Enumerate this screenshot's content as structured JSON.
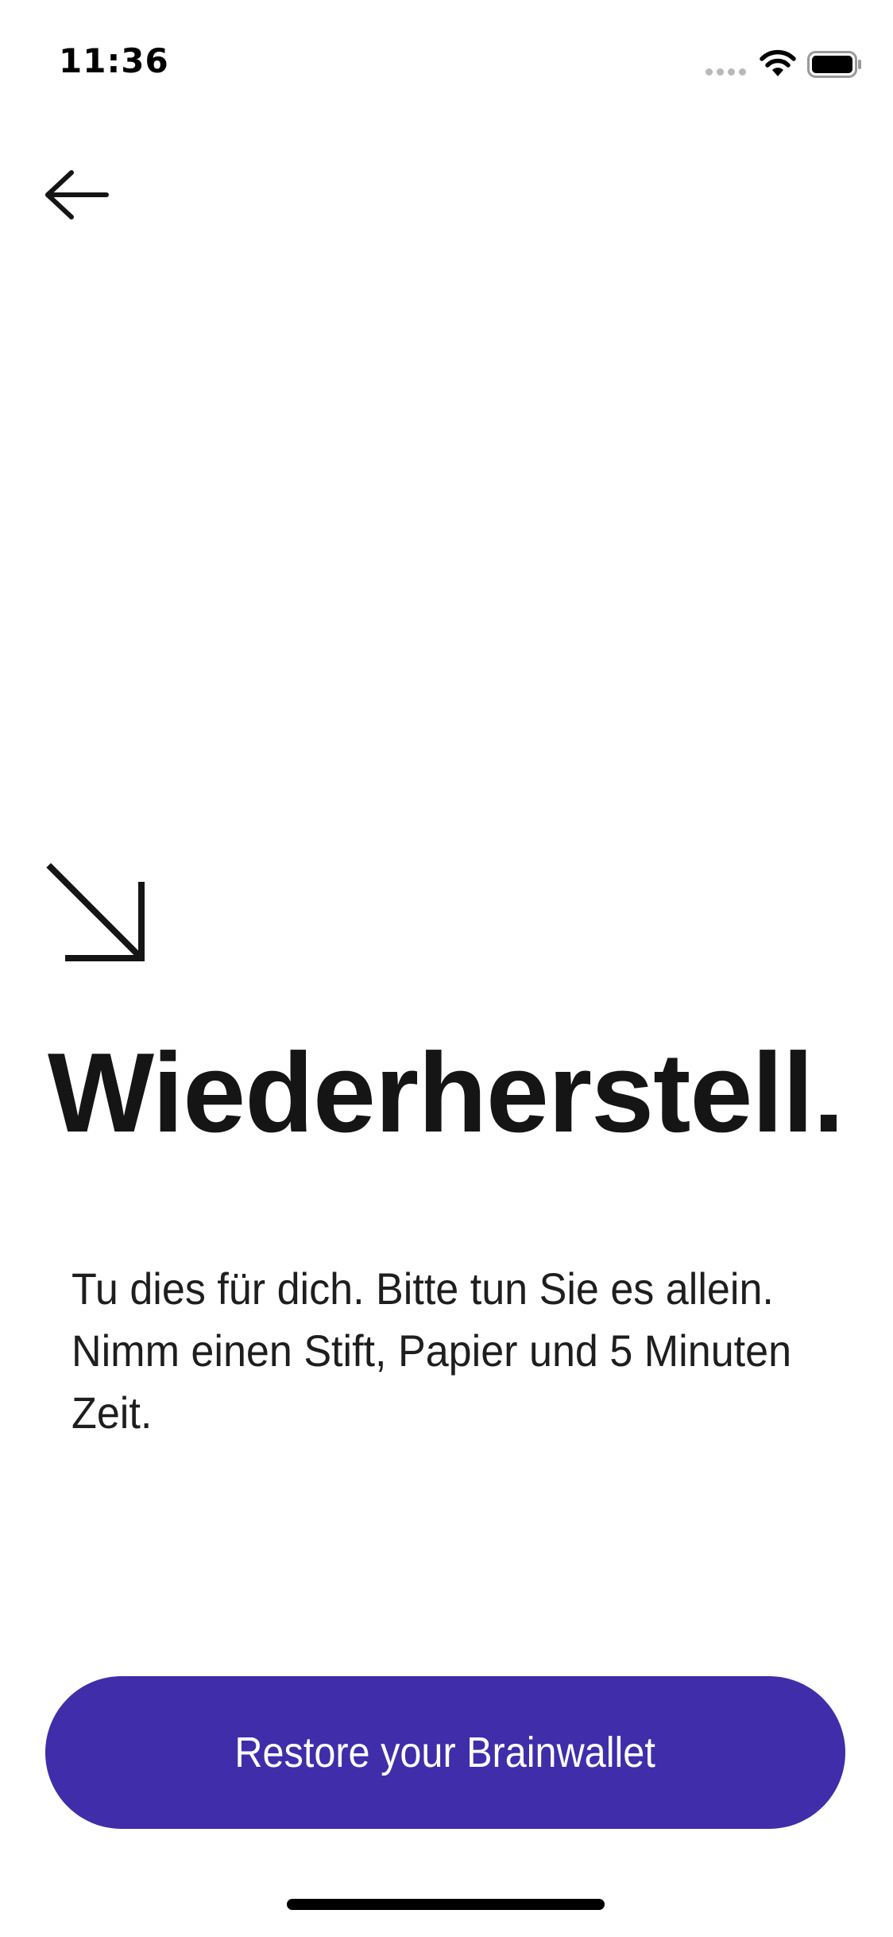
{
  "status_bar": {
    "time": "11:36",
    "icons": [
      "cellular-signal-icon",
      "wifi-icon",
      "battery-icon"
    ]
  },
  "nav": {
    "back_icon": "arrow-left-icon"
  },
  "hero": {
    "icon": "arrow-down-right-icon",
    "title": "Wiederherstell...",
    "description": "Tu dies für dich. Bitte tun Sie es allein. Nimm einen Stift, Papier und 5 Minuten Zeit."
  },
  "actions": {
    "primary_label": "Restore your Brainwallet"
  },
  "colors": {
    "accent": "#3f2daa",
    "text": "#151515",
    "background": "#ffffff"
  }
}
